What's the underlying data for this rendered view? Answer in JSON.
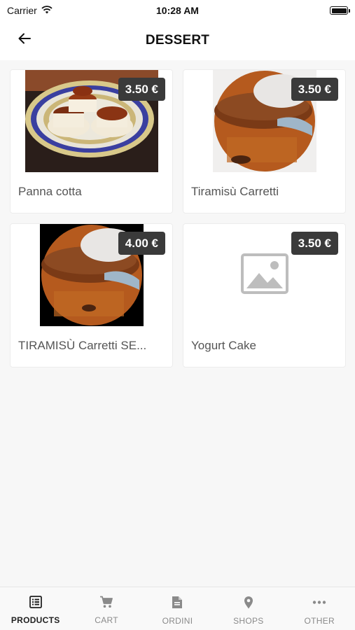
{
  "status_bar": {
    "carrier": "Carrier",
    "time": "10:28 AM"
  },
  "header": {
    "title": "DESSERT"
  },
  "products": [
    {
      "name": "Panna cotta",
      "price": "3.50 €",
      "image": "panna-cotta"
    },
    {
      "name": "Tiramisù Carretti",
      "price": "3.50 €",
      "image": "tiramisu"
    },
    {
      "name": "TIRAMISÙ Carretti SE...",
      "price": "4.00 €",
      "image": "tiramisu"
    },
    {
      "name": "Yogurt Cake",
      "price": "3.50 €",
      "image": "placeholder-image-icon"
    }
  ],
  "nav": {
    "items": [
      {
        "label": "PRODUCTS",
        "icon": "list-icon",
        "active": true
      },
      {
        "label": "CART",
        "icon": "cart-icon",
        "active": false
      },
      {
        "label": "ORDINI",
        "icon": "document-icon",
        "active": false
      },
      {
        "label": "SHOPS",
        "icon": "location-pin-icon",
        "active": false
      },
      {
        "label": "OTHER",
        "icon": "more-icon",
        "active": false
      }
    ]
  },
  "colors": {
    "badge_bg": "#3a3a3a",
    "active_nav": "#222222",
    "inactive_nav": "#8a8a8a"
  }
}
